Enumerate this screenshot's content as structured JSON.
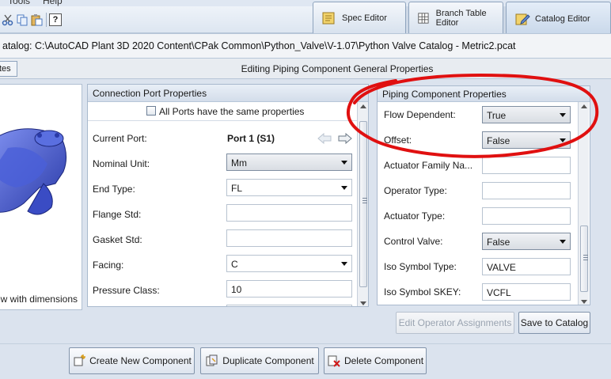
{
  "menubar": {
    "items": [
      "Tools",
      "Help"
    ]
  },
  "toolbar": {
    "icons": [
      "cut-icon",
      "copy-icon",
      "paste-icon",
      "help-icon"
    ],
    "help_glyph": "?"
  },
  "tabs": [
    {
      "label": "Spec Editor",
      "icon": "spec-editor-icon",
      "active": false
    },
    {
      "label": "Branch Table Editor",
      "icon": "branch-table-icon",
      "active": false
    },
    {
      "label": "Catalog Editor",
      "icon": "catalog-editor-icon",
      "active": true
    }
  ],
  "catalog_path": "atalog: C:\\AutoCAD Plant 3D 2020 Content\\CPak Common\\Python_Valve\\V-1.07\\Python Valve Catalog - Metric2.pcat",
  "left_tab_label": "tes",
  "edit_title": "Editing Piping Component General Properties",
  "preview": {
    "caption": "w with dimensions"
  },
  "connection_port": {
    "title": "Connection Port Properties",
    "all_ports_label": "All Ports have the same properties",
    "all_ports_checked": false,
    "rows": [
      {
        "label": "Current Port:",
        "value": "Port 1 (S1)",
        "kind": "port"
      },
      {
        "label": "Nominal Unit:",
        "value": "Mm",
        "kind": "combo-dark"
      },
      {
        "label": "End Type:",
        "value": "FL",
        "kind": "combo"
      },
      {
        "label": "Flange Std:",
        "value": "",
        "kind": "text"
      },
      {
        "label": "Gasket Std:",
        "value": "",
        "kind": "text"
      },
      {
        "label": "Facing:",
        "value": "C",
        "kind": "combo"
      },
      {
        "label": "Pressure Class:",
        "value": "10",
        "kind": "text"
      }
    ]
  },
  "piping_component": {
    "title": "Piping Component Properties",
    "rows": [
      {
        "label": "Flow Dependent:",
        "value": "True",
        "kind": "combo-dark"
      },
      {
        "label": "Offset:",
        "value": "False",
        "kind": "combo-dark"
      },
      {
        "label": "Actuator Family Na...",
        "value": "",
        "kind": "text"
      },
      {
        "label": "Operator Type:",
        "value": "",
        "kind": "text"
      },
      {
        "label": "Actuator Type:",
        "value": "",
        "kind": "text"
      },
      {
        "label": "Control Valve:",
        "value": "False",
        "kind": "combo-dark"
      },
      {
        "label": "Iso Symbol Type:",
        "value": "VALVE",
        "kind": "text"
      },
      {
        "label": "Iso Symbol SKEY:",
        "value": "VCFL",
        "kind": "text"
      }
    ]
  },
  "buttons": {
    "edit_operator": "Edit Operator Assignments",
    "save_catalog": "Save to Catalog",
    "create_new": "Create New Component",
    "duplicate": "Duplicate Component",
    "delete": "Delete Component"
  },
  "colors": {
    "annotation": "#e01010",
    "accent": "#1f4fa8"
  }
}
